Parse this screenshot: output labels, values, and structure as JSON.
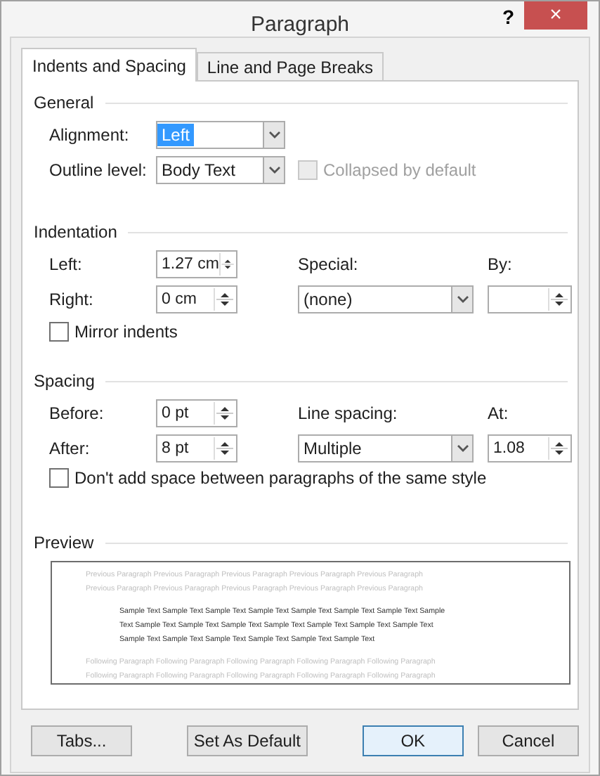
{
  "window": {
    "title": "Paragraph",
    "help": "?",
    "close": "×"
  },
  "tabs": [
    {
      "label": "Indents and Spacing",
      "selected": true
    },
    {
      "label": "Line and Page Breaks",
      "selected": false
    }
  ],
  "general": {
    "title": "General",
    "alignment": {
      "label": "Alignment:",
      "value": "Left",
      "text_selected": true
    },
    "outline_level": {
      "label": "Outline level:",
      "value": "Body Text"
    },
    "collapsed": {
      "label": "Collapsed by default",
      "checked": false,
      "disabled": true
    }
  },
  "indentation": {
    "title": "Indentation",
    "left": {
      "label": "Left:",
      "value": "1.27 cm"
    },
    "right": {
      "label": "Right:",
      "value": "0 cm"
    },
    "special": {
      "label": "Special:",
      "value": "(none)"
    },
    "by": {
      "label": "By:"
    },
    "mirror": {
      "label": "Mirror indents",
      "checked": false
    }
  },
  "spacing": {
    "title": "Spacing",
    "before": {
      "label": "Before:",
      "value": "0 pt"
    },
    "after": {
      "label": "After:",
      "value": "8 pt"
    },
    "line_spacing": {
      "label": "Line spacing:",
      "value": "Multiple"
    },
    "at": {
      "label": "At:",
      "value": "1.08"
    },
    "dont_add": {
      "label": "Don't add space between paragraphs of the same style",
      "checked": false
    }
  },
  "preview": {
    "title": "Preview",
    "previous": [
      "Previous Paragraph Previous Paragraph Previous Paragraph Previous Paragraph Previous Paragraph",
      "Previous Paragraph Previous Paragraph Previous Paragraph Previous Paragraph Previous Paragraph"
    ],
    "sample": [
      "Sample Text Sample Text Sample Text Sample Text Sample Text Sample Text Sample Text Sample",
      "Text Sample Text Sample Text Sample Text Sample Text Sample Text Sample Text Sample Text",
      "Sample Text Sample Text Sample Text Sample Text Sample Text Sample Text"
    ],
    "following": [
      "Following Paragraph Following Paragraph Following Paragraph Following Paragraph Following Paragraph",
      "Following Paragraph Following Paragraph Following Paragraph Following Paragraph Following Paragraph"
    ]
  },
  "buttons": [
    {
      "label": "Tabs...",
      "default": false
    },
    {
      "label": "Set As Default",
      "default": false
    },
    {
      "label": "OK",
      "default": true
    },
    {
      "label": "Cancel",
      "default": false
    }
  ]
}
